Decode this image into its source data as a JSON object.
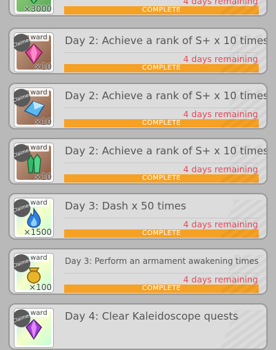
{
  "colors": {
    "bar": "#f5a125",
    "remaining": "#e64a5a",
    "card": "#dcdcdc",
    "background": "#b9b9b9"
  },
  "quests": [
    {
      "title": "",
      "remaining": "4 days remaining",
      "status": "COMPLETE",
      "reward_label": "",
      "claimed": "",
      "qty": "×3000",
      "icon": "green-gem-icon"
    },
    {
      "title": "Day 2: Achieve a rank of S+  x 10 times",
      "remaining": "4 days remaining",
      "status": "COMPLETE",
      "reward_label": "ward",
      "claimed": "Claimed",
      "qty": "×10",
      "icon": "pink-crystal-icon"
    },
    {
      "title": "Day 2: Achieve a rank of S+  x 10 times",
      "remaining": "4 days remaining",
      "status": "COMPLETE",
      "reward_label": "ward",
      "claimed": "Claimed",
      "qty": "×10",
      "icon": "blue-crystal-icon"
    },
    {
      "title": "Day 2: Achieve a rank of S+  x 10 times",
      "remaining": "4 days remaining",
      "status": "COMPLETE",
      "reward_label": "ward",
      "claimed": "Claimed",
      "qty": "×10",
      "icon": "green-crystal-icon"
    },
    {
      "title": "Day 3: Dash  x 50 times",
      "remaining": "4 days remaining",
      "status": "COMPLETE",
      "reward_label": "ward",
      "claimed": "Claimed",
      "qty": "×1500",
      "icon": "blue-flame-icon"
    },
    {
      "title": "Day 3: Perform an armament awakening  times",
      "remaining": "4 days remaining",
      "status": "COMPLETE",
      "reward_label": "ward",
      "claimed": "Claimed",
      "qty": "×100",
      "icon": "gold-pouch-icon"
    },
    {
      "title": "Day 4: Clear  Kaleidoscope quests",
      "remaining": "",
      "status": "",
      "reward_label": "ward",
      "claimed": "Claimed",
      "qty": "",
      "icon": "purple-gem-icon"
    }
  ]
}
